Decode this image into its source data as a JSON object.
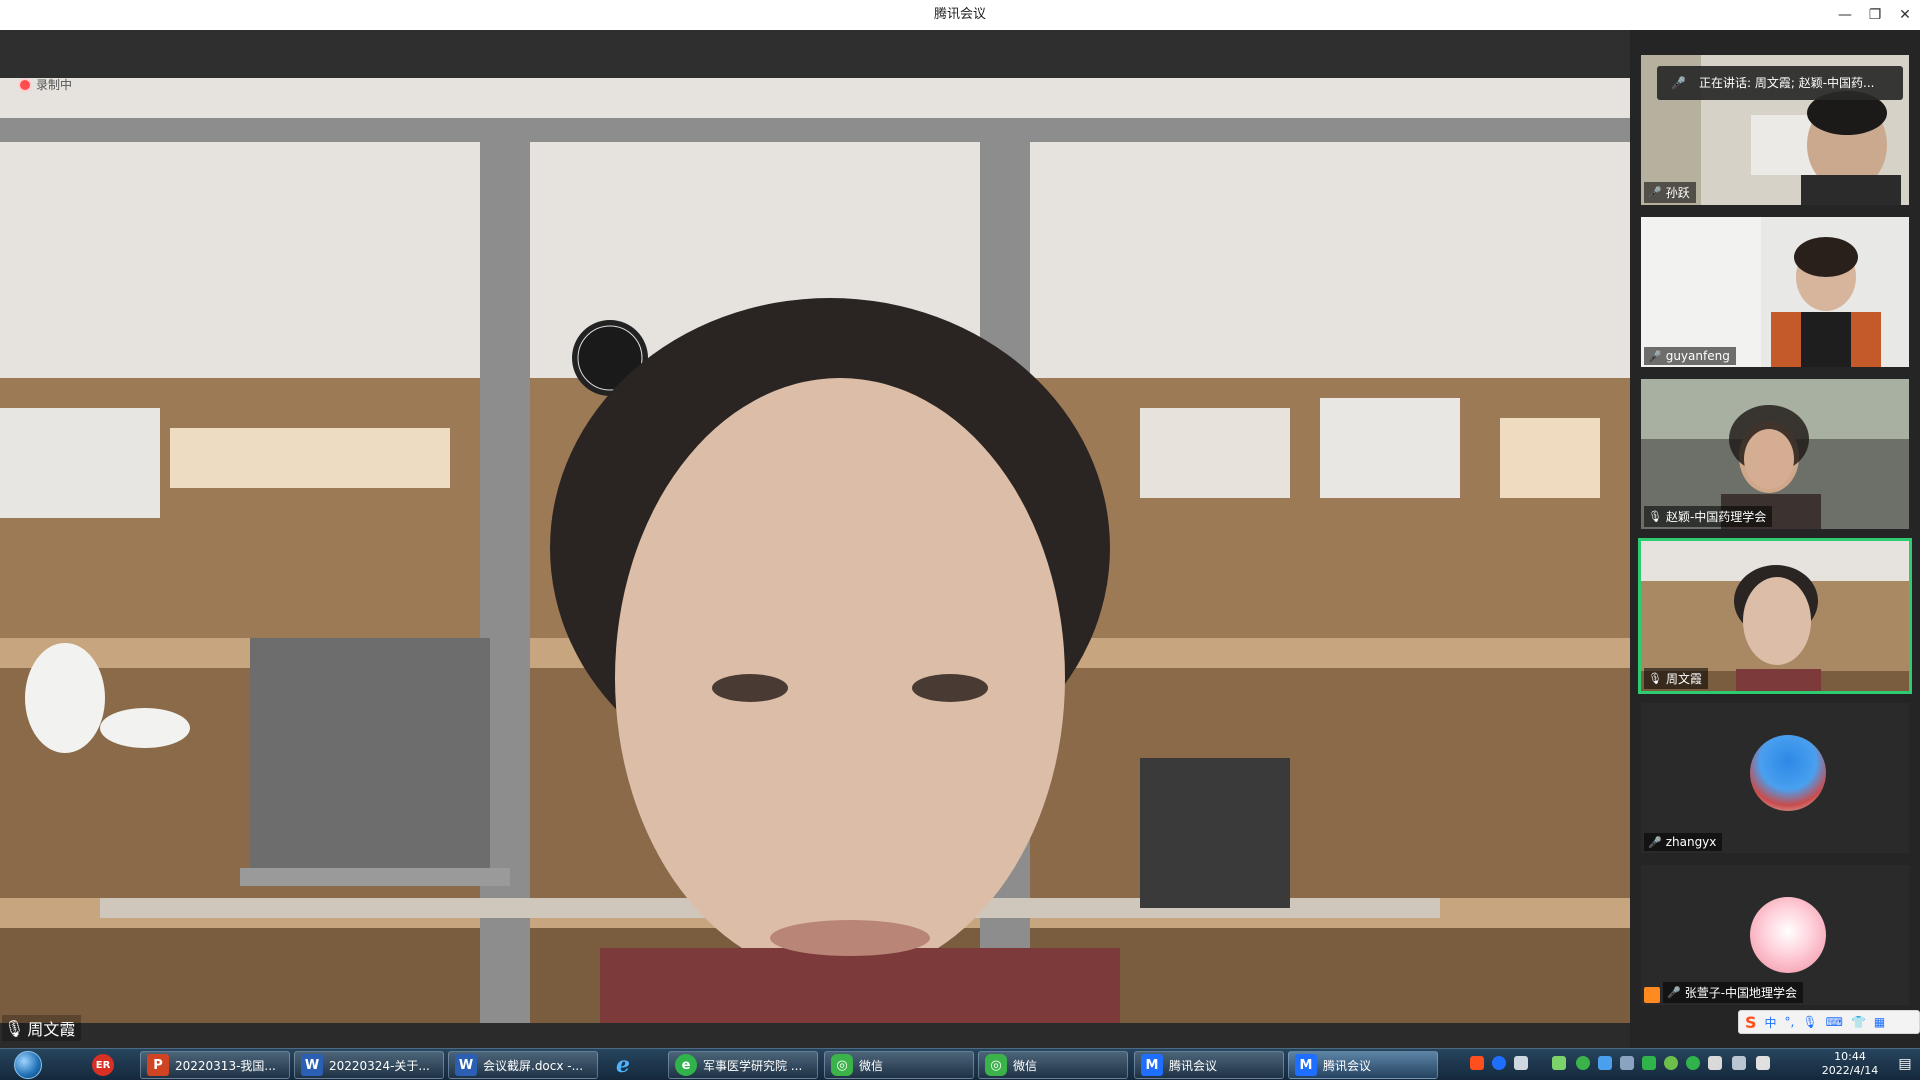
{
  "window": {
    "title": "腾讯会议",
    "controls": [
      "—",
      "❐",
      "✕"
    ]
  },
  "main": {
    "recording_label": "录制中",
    "speaker_name": "周文霞"
  },
  "sidebar": {
    "speaking_banner": "正在讲话: 周文霞; 赵颖-中国药...",
    "tiles": [
      {
        "name": "孙跃",
        "mic": "muted"
      },
      {
        "name": "guyanfeng",
        "mic": "muted"
      },
      {
        "name": "赵颖-中国药理学会",
        "mic": "on"
      },
      {
        "name": "周文霞",
        "mic": "on"
      },
      {
        "name": "zhangyx",
        "mic": "muted"
      },
      {
        "name": "张萱子-中国地理学会",
        "mic": "muted"
      }
    ]
  },
  "taskbar": {
    "items": [
      {
        "label": "20220313-我国..."
      },
      {
        "label": "20220324-关于..."
      },
      {
        "label": "会议截屏.docx -..."
      },
      {
        "label": "军事医学研究院 ..."
      },
      {
        "label": "微信"
      },
      {
        "label": "微信"
      },
      {
        "label": "腾讯会议"
      },
      {
        "label": "腾讯会议"
      }
    ],
    "clock_time": "10:44",
    "clock_date": "2022/4/14"
  },
  "ime": {
    "mode": "中"
  },
  "colors": {
    "active_tile_border": "#2ecc71",
    "recording_dot": "#ff4d4f",
    "taskbar": "#1b3650"
  }
}
